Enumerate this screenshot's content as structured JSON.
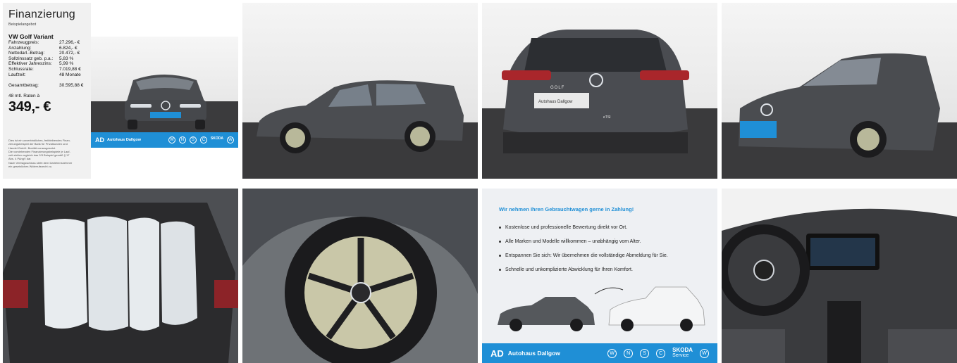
{
  "finance": {
    "title": "Finanzierung",
    "subtitle": "Beispielangebot",
    "model": "VW Golf Variant",
    "rows": [
      {
        "label": "Fahrzeugpreis:",
        "value": "27.296,- €"
      },
      {
        "label": "Anzahlung:",
        "value": "6.824,- €"
      },
      {
        "label": "Nettodarl.-Betrag:",
        "value": "20.472,- €"
      },
      {
        "label": "Sollzinssatz geb. p.a.:",
        "value": "5,83 %"
      },
      {
        "label": "Effektiver Jahreszins:",
        "value": "5,99 %"
      },
      {
        "label": "Schlussrate:",
        "value": "7.019,88 €"
      },
      {
        "label": "Laufzeit:",
        "value": "48 Monate"
      }
    ],
    "total_label": "Gesamtbetrag:",
    "total_value": "30.595,88 €",
    "rate_label": "48 mtl. Raten à",
    "rate_value": "349,- €",
    "disclaimer": [
      "Dies ist ein unverbindliches, freibleibendes Finan-",
      "zierungsbeispiel der Bank für Privatkunden und",
      "Handel GmbH. Bonität vorausgesetzt.",
      "Die vorstehenden Finanzierungsbeispiele je Lauf-",
      "zeit stellen zugleich das 2/3 Beispiel gemäß § 17",
      "Abs. 4 PAngV dar.",
      "Nach Vertragsschluss steht dem Darlehensnehmer",
      "ein gesetzliches Widerrufsrecht zu."
    ]
  },
  "dealer": {
    "logo": "AD",
    "name": "Autohaus Dallgow",
    "brands": [
      "VW",
      "VW Nutzfahrzeuge",
      "SEAT",
      "CUPRA",
      "SKODA Service",
      "VW Nutzfahrzeuge Service"
    ],
    "brand_skoda": "SKODA",
    "brand_skoda_sub": "Service",
    "accent_color": "#1f8fd6"
  },
  "tradein": {
    "headline": "Wir nehmen Ihren Gebrauchtwagen gerne in Zahlung!",
    "bullets": [
      "Kostenlose und professionelle Bewertung direkt vor Ort.",
      "Alle Marken und Modelle willkommen – unabhängig vom Alter.",
      "Entspannen Sie sich: Wir übernehmen die vollständige Abmeldung für Sie.",
      "Schnelle und unkomplizierte Abwicklung für Ihren Komfort."
    ]
  },
  "photos": {
    "rear_badge": "GOLF",
    "rear_trim": "eTSI",
    "plate_text": "Autohaus Dallgow"
  }
}
